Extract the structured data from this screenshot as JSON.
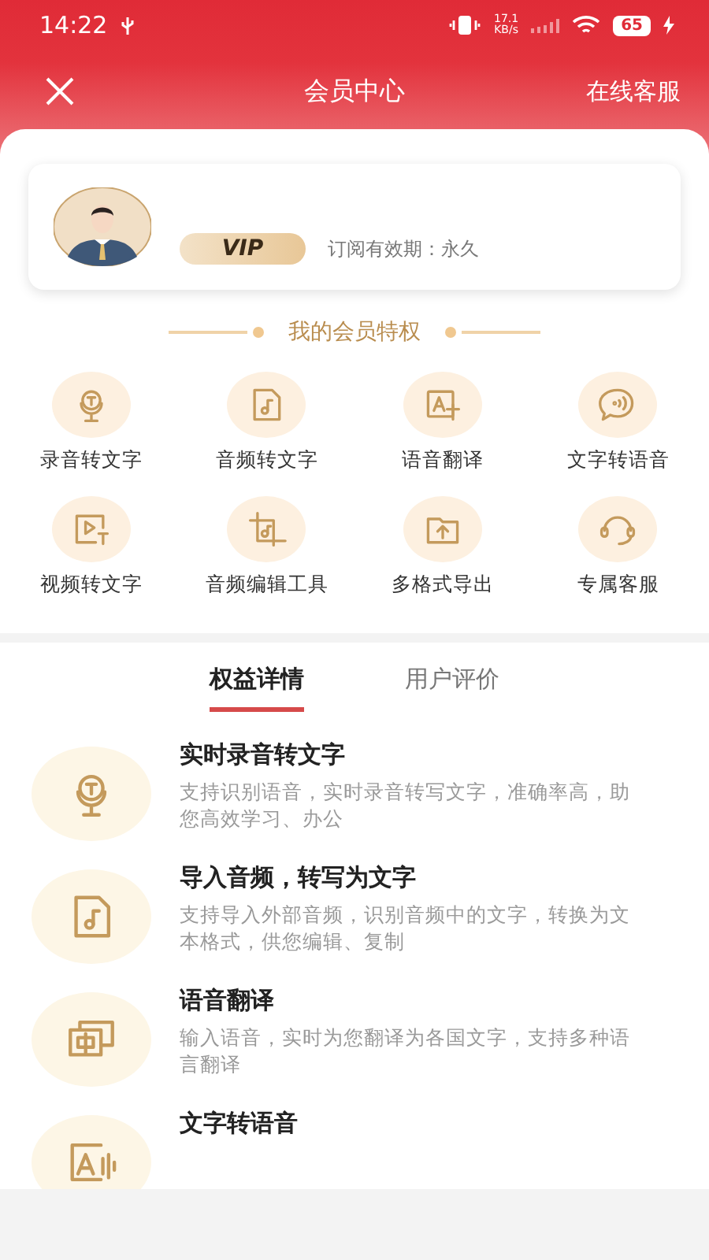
{
  "status_bar": {
    "time": "14:22",
    "net_speed": "17.1",
    "net_unit": "KB/s",
    "battery": "65"
  },
  "header": {
    "title": "会员中心",
    "service": "在线客服"
  },
  "profile": {
    "badge": "VIP",
    "validity": "订阅有效期：永久"
  },
  "privileges": {
    "title": "我的会员特权",
    "items": [
      {
        "label": "录音转文字",
        "kind": "mic"
      },
      {
        "label": "音频转文字",
        "kind": "audio"
      },
      {
        "label": "语音翻译",
        "kind": "translate"
      },
      {
        "label": "文字转语音",
        "kind": "speech"
      },
      {
        "label": "视频转文字",
        "kind": "video"
      },
      {
        "label": "音频编辑工具",
        "kind": "crop"
      },
      {
        "label": "多格式导出",
        "kind": "export"
      },
      {
        "label": "专属客服",
        "kind": "headset"
      }
    ]
  },
  "tabs": [
    {
      "label": "权益详情",
      "selected": true
    },
    {
      "label": "用户评价",
      "selected": false
    }
  ],
  "details": [
    {
      "kind": "mic",
      "title": "实时录音转文字",
      "text": "支持识别语音，实时录音转写文字，准确率高，助您高效学习、办公"
    },
    {
      "kind": "audio",
      "title": "导入音频，转写为文字",
      "text": "支持导入外部音频，识别音频中的文字，转换为文本格式，供您编辑、复制"
    },
    {
      "kind": "chinese",
      "title": "语音翻译",
      "text": "输入语音，实时为您翻译为各国文字，支持多种语言翻译"
    },
    {
      "kind": "speech-a",
      "title": "文字转语音"
    }
  ]
}
